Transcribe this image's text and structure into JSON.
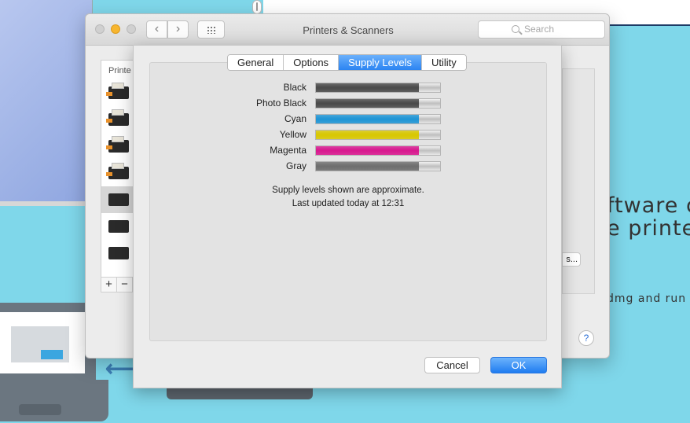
{
  "background": {
    "text_line1": "ftware c",
    "text_line2": "e printe",
    "text_line3": "dmg and run"
  },
  "window": {
    "title": "Printers & Scanners",
    "search_placeholder": "Search",
    "printer_list_header": "Printe",
    "add_label": "+",
    "remove_label": "−",
    "options_button_fragment": "s...",
    "help_label": "?"
  },
  "sheet": {
    "tabs": [
      {
        "label": "General",
        "active": false
      },
      {
        "label": "Options",
        "active": false
      },
      {
        "label": "Supply Levels",
        "active": true
      },
      {
        "label": "Utility",
        "active": false
      }
    ],
    "supplies": [
      {
        "name": "Black",
        "level": 0.83,
        "color": "#4a4a4a"
      },
      {
        "name": "Photo Black",
        "level": 0.83,
        "color": "#4a4a4a"
      },
      {
        "name": "Cyan",
        "level": 0.83,
        "color": "#1e95d6"
      },
      {
        "name": "Yellow",
        "level": 0.83,
        "color": "#d9c800"
      },
      {
        "name": "Magenta",
        "level": 0.83,
        "color": "#d8178f"
      },
      {
        "name": "Gray",
        "level": 0.83,
        "color": "#6e6e6e"
      }
    ],
    "note_line1": "Supply levels shown are approximate.",
    "note_line2": "Last updated today at 12:31",
    "cancel_label": "Cancel",
    "ok_label": "OK"
  }
}
